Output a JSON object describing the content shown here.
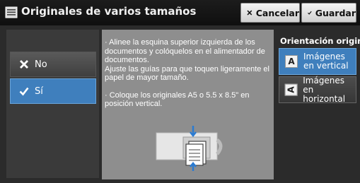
{
  "header": {
    "title": "Originales de varios tamaños",
    "cancel_label": "Cancelar",
    "save_label": "Guardar"
  },
  "options": {
    "no_label": "No",
    "si_label": "Sí",
    "selected": "Sí"
  },
  "instructions": {
    "paragraph1": "· Alinee la esquina superior izquierda de los documentos y colóquelos en el alimentador de documentos.",
    "paragraph2": "Ajuste las guías para que toquen ligeramente el papel de mayor tamaño.",
    "paragraph3": "· Coloque los originales A5 o 5.5 x 8.5\" en posición vertical."
  },
  "orientation": {
    "label": "Orientación original",
    "vertical_line1": "Imágenes",
    "vertical_line2": "en vertical",
    "horizontal_line1": "Imágenes",
    "horizontal_line2": "en horizontal",
    "selected": "vertical"
  },
  "colors": {
    "selected": "#3f7fbd",
    "header_bg": "#111111",
    "panel_bg": "#8e8e8e"
  },
  "icons": [
    "document-icon",
    "close-icon",
    "check-icon",
    "letter-a-icon",
    "document-feeder-icon"
  ]
}
